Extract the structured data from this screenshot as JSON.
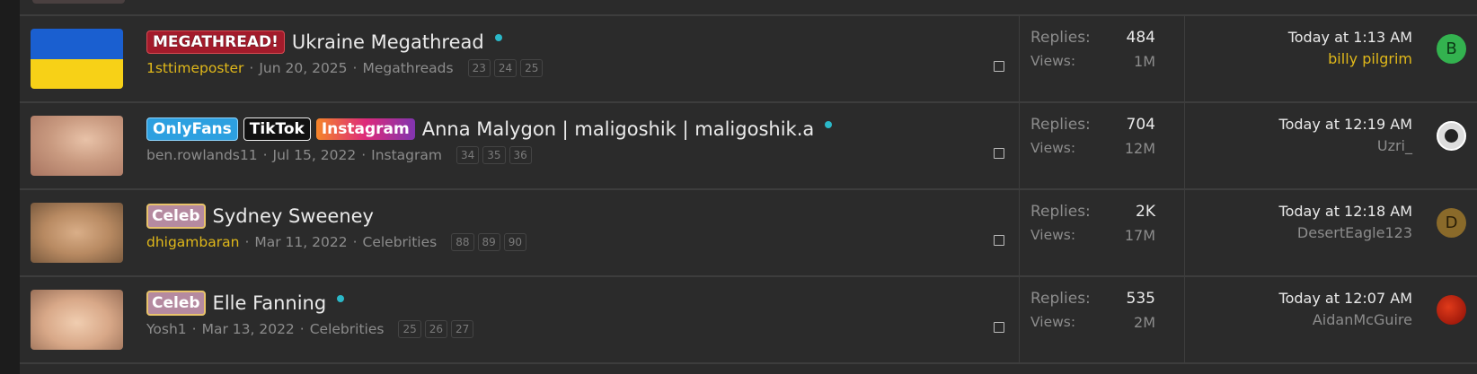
{
  "threads": [
    {
      "prefixes": [
        "MEGATHREAD!"
      ],
      "title": "Ukraine Megathread",
      "unread": true,
      "author": "1sttimeposter",
      "date": "Jun 20, 2025",
      "forum": "Megathreads",
      "pages": [
        "23",
        "24",
        "25"
      ],
      "replies_label": "Replies:",
      "replies": "484",
      "views_label": "Views:",
      "views": "1M",
      "last_time": "Today at 1:13 AM",
      "last_user": "billy pilgrim",
      "avatar_letter": "B"
    },
    {
      "prefixes": [
        "OnlyFans",
        "TikTok",
        "Instagram"
      ],
      "title": "Anna Malygon | maligoshik | maligoshik.a",
      "unread": true,
      "author": "ben.rowlands11",
      "date": "Jul 15, 2022",
      "forum": "Instagram",
      "pages": [
        "34",
        "35",
        "36"
      ],
      "replies_label": "Replies:",
      "replies": "704",
      "views_label": "Views:",
      "views": "12M",
      "last_time": "Today at 12:19 AM",
      "last_user": "Uzri_",
      "avatar_letter": ""
    },
    {
      "prefixes": [
        "Celeb"
      ],
      "title": "Sydney Sweeney",
      "unread": false,
      "author": "dhigambaran",
      "date": "Mar 11, 2022",
      "forum": "Celebrities",
      "pages": [
        "88",
        "89",
        "90"
      ],
      "replies_label": "Replies:",
      "replies": "2K",
      "views_label": "Views:",
      "views": "17M",
      "last_time": "Today at 12:18 AM",
      "last_user": "DesertEagle123",
      "avatar_letter": "D"
    },
    {
      "prefixes": [
        "Celeb"
      ],
      "title": "Elle Fanning",
      "unread": true,
      "author": "Yosh1",
      "date": "Mar 13, 2022",
      "forum": "Celebrities",
      "pages": [
        "25",
        "26",
        "27"
      ],
      "replies_label": "Replies:",
      "replies": "535",
      "views_label": "Views:",
      "views": "2M",
      "last_time": "Today at 12:07 AM",
      "last_user": "AidanMcGuire",
      "avatar_letter": ""
    }
  ],
  "colors": {
    "unread_dot": "#2bb8c8",
    "gold_username": "#e0b81a",
    "megathread_badge": "#a31b2b"
  }
}
